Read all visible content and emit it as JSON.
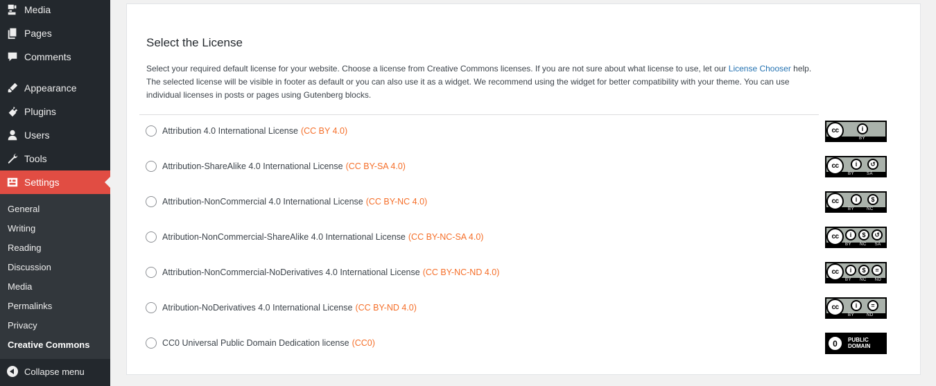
{
  "sidebar": {
    "items": [
      {
        "label": "Media",
        "icon": "media-icon"
      },
      {
        "label": "Pages",
        "icon": "pages-icon"
      },
      {
        "label": "Comments",
        "icon": "comments-icon"
      },
      {
        "label": "Appearance",
        "icon": "appearance-icon"
      },
      {
        "label": "Plugins",
        "icon": "plugins-icon"
      },
      {
        "label": "Users",
        "icon": "users-icon"
      },
      {
        "label": "Tools",
        "icon": "tools-icon"
      },
      {
        "label": "Settings",
        "icon": "settings-icon",
        "active": true
      }
    ],
    "submenu": [
      "General",
      "Writing",
      "Reading",
      "Discussion",
      "Media",
      "Permalinks",
      "Privacy",
      "Creative Commons"
    ],
    "collapse_label": "Collapse menu",
    "active_color": "#e14d43"
  },
  "main": {
    "title": "Select the License",
    "desc_before": "Select your required default license for your website. Choose a license from Creative Commons licenses. If you are not sure about what license to use, let our ",
    "desc_link": "License Chooser",
    "desc_after": " help. The selected license will be visible in footer as default or you can also use it as a widget. We recommend using the widget for better compatibility with your theme. You can use individual licenses in posts or pages using Gutenberg blocks.",
    "licenses": [
      {
        "name": "Attribution 4.0 International License",
        "code": "(CC BY 4.0)",
        "badge_tags": [
          "BY"
        ]
      },
      {
        "name": "Attribution-ShareAlike 4.0 International License",
        "code": "(CC BY-SA 4.0)",
        "badge_tags": [
          "BY",
          "SA"
        ]
      },
      {
        "name": "Attribution-NonCommercial 4.0 International License",
        "code": "(CC BY-NC 4.0)",
        "badge_tags": [
          "BY",
          "NC"
        ]
      },
      {
        "name": "Atribution-NonCommercial-ShareAlike 4.0 International License",
        "code": "(CC BY-NC-SA 4.0)",
        "badge_tags": [
          "BY",
          "NC",
          "SA"
        ]
      },
      {
        "name": "Attribution-NonCommercial-NoDerivatives 4.0 International License",
        "code": "(CC BY-NC-ND 4.0)",
        "badge_tags": [
          "BY",
          "NC",
          "ND"
        ]
      },
      {
        "name": "Atribution-NoDerivatives 4.0 International License",
        "code": "(CC BY-ND 4.0)",
        "badge_tags": [
          "BY",
          "ND"
        ]
      },
      {
        "name": "CC0 Universal Public Domain Dedication license",
        "code": "(CC0)",
        "badge_tags": []
      }
    ],
    "pd_badge": {
      "line1": "PUBLIC",
      "line2": "DOMAIN",
      "mark": "0"
    },
    "cc_mark": "cc",
    "code_color": "#f56e28"
  }
}
